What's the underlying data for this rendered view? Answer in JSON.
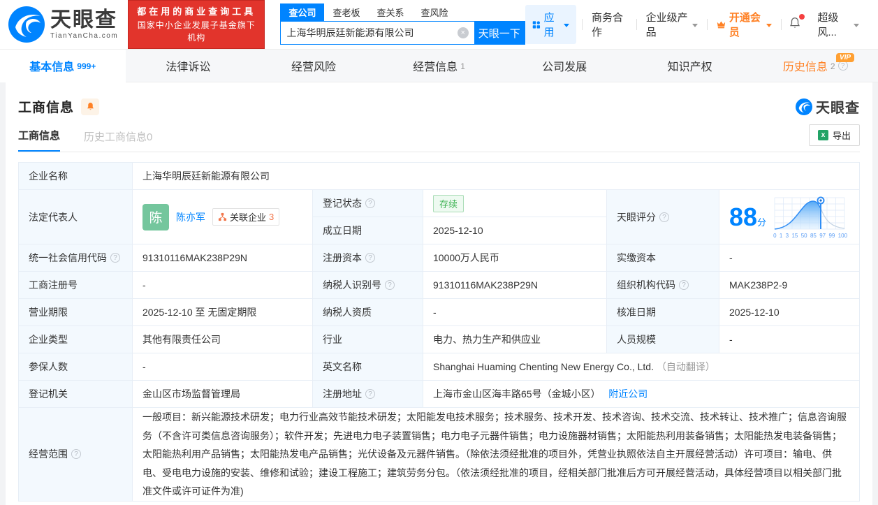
{
  "brand": {
    "name": "天眼查",
    "domain": "TianYanCha.com",
    "slogan_line1": "都在用的商业查询工具",
    "slogan_line2": "国家中小企业发展子基金旗下机构",
    "accent_blue": "#0084ff",
    "accent_orange": "#ff8125"
  },
  "icons": {
    "help": "?",
    "clear": "×",
    "excel": "x"
  },
  "search": {
    "tabs": [
      "查公司",
      "查老板",
      "查关系",
      "查风险"
    ],
    "active_tab": "查公司",
    "value": "上海华明辰廷新能源有限公司",
    "button": "天眼一下"
  },
  "topnav": {
    "apps": "应用",
    "business": "商务合作",
    "enterprise": "企业级产品",
    "vip": "开通会员",
    "risk": "超级风..."
  },
  "tabs": [
    {
      "label": "基本信息",
      "count": "999+"
    },
    {
      "label": "法律诉讼"
    },
    {
      "label": "经营风险"
    },
    {
      "label": "经营信息",
      "count": "1"
    },
    {
      "label": "公司发展"
    },
    {
      "label": "知识产权"
    },
    {
      "label": "历史信息",
      "count": "2",
      "vip": "VIP"
    }
  ],
  "section": {
    "title": "工商信息",
    "subtab_active": "工商信息",
    "subtab_history": "历史工商信息",
    "subtab_history_count": "0",
    "export": "导出",
    "watermark": "天眼查"
  },
  "fields": {
    "company_name": {
      "label": "企业名称",
      "value": "上海华明辰廷新能源有限公司"
    },
    "legal_rep": {
      "label": "法定代表人",
      "avatar": "陈",
      "name": "陈亦军",
      "related_label": "关联企业",
      "related_count": "3"
    },
    "reg_status": {
      "label": "登记状态",
      "value": "存续"
    },
    "est_date": {
      "label": "成立日期",
      "value": "2025-12-10"
    },
    "score": {
      "label": "天眼评分",
      "value": "88",
      "unit": "分",
      "ticks": [
        "0",
        "1",
        "3",
        "15",
        "50",
        "85",
        "97",
        "99",
        "100"
      ]
    },
    "credit_code": {
      "label": "统一社会信用代码",
      "value": "91310116MAK238P29N"
    },
    "reg_capital": {
      "label": "注册资本",
      "value": "10000万人民币"
    },
    "paid_capital": {
      "label": "实缴资本",
      "value": "-"
    },
    "reg_number": {
      "label": "工商注册号",
      "value": "-"
    },
    "taxpayer_id": {
      "label": "纳税人识别号",
      "value": "91310116MAK238P29N"
    },
    "org_code": {
      "label": "组织机构代码",
      "value": "MAK238P2-9"
    },
    "biz_term": {
      "label": "营业期限",
      "value": "2025-12-10 至 无固定期限"
    },
    "taxpayer_quality": {
      "label": "纳税人资质",
      "value": "-"
    },
    "approve_date": {
      "label": "核准日期",
      "value": "2025-12-10"
    },
    "company_type": {
      "label": "企业类型",
      "value": "其他有限责任公司"
    },
    "industry": {
      "label": "行业",
      "value": "电力、热力生产和供应业"
    },
    "staff_size": {
      "label": "人员规模",
      "value": "-"
    },
    "insured_count": {
      "label": "参保人数",
      "value": "-"
    },
    "english_name": {
      "label": "英文名称",
      "value": "Shanghai Huaming Chenting New Energy Co., Ltd.",
      "note": "（自动翻译）"
    },
    "reg_authority": {
      "label": "登记机关",
      "value": "金山区市场监督管理局"
    },
    "reg_address": {
      "label": "注册地址",
      "value": "上海市金山区海丰路65号（金城小区）",
      "link": "附近公司"
    },
    "biz_scope": {
      "label": "经营范围",
      "value": "一般项目：新兴能源技术研发；电力行业高效节能技术研发；太阳能发电技术服务；技术服务、技术开发、技术咨询、技术交流、技术转让、技术推广；信息咨询服务（不含许可类信息咨询服务）；软件开发；先进电力电子装置销售；电力电子元器件销售；电力设施器材销售；太阳能热利用装备销售；太阳能热发电装备销售；太阳能热利用产品销售；太阳能热发电产品销售；光伏设备及元器件销售。（除依法须经批准的项目外，凭营业执照依法自主开展经营活动）许可项目：输电、供电、受电电力设施的安装、维修和试验；建设工程施工；建筑劳务分包。（依法须经批准的项目，经相关部门批准后方可开展经营活动，具体经营项目以相关部门批准文件或许可证件为准)"
    }
  },
  "chart_data": {
    "type": "area",
    "title": "天眼评分分布曲线",
    "x_tick_labels": [
      "0",
      "1",
      "3",
      "15",
      "50",
      "85",
      "97",
      "99",
      "100"
    ],
    "marker_value": 88,
    "shape": "bell curve peaking near tick 50, marker pin at score 88, right tail unshaded",
    "grid": true
  }
}
